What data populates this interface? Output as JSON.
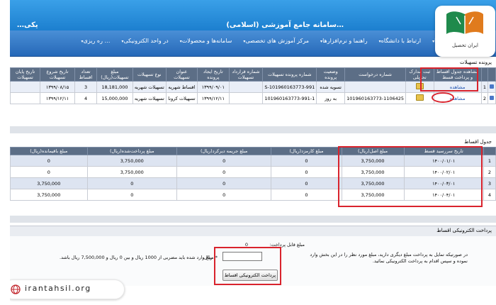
{
  "header": {
    "title": "…سامانه جامع آموزشی (اسلامی)",
    "left_fragment": "…یکی"
  },
  "nav": {
    "items": [
      {
        "label": "… ره ریزی"
      },
      {
        "label": "در واحد الکترونیکی"
      },
      {
        "label": "سامانه‌ها و محصولات"
      },
      {
        "label": "مرکز آموزش های تخصصی"
      },
      {
        "label": "راهنما و نرم‌افزارها"
      },
      {
        "label": "ارتباط با دانشگاه"
      },
      {
        "label": "سامانه مبدا"
      },
      {
        "label": "جستجو"
      }
    ]
  },
  "loans": {
    "section_label": "پرونده تسهیلات",
    "headers": [
      "",
      "",
      "مشاهده جدول اقساط و پرداخت قسط",
      "ثبت مدارک تحویلی",
      "شماره درخواست",
      "وضعیت پرونده",
      "شماره پرونده تسهیلات",
      "شماره قرارداد تسهیلات",
      "تاریخ ایجاد پرونده",
      "عنوان تسهیلات",
      "نوع تسهیلات",
      "مبلغ تسهیلات(ریال)",
      "تعداد اقساط",
      "تاریخ شروع تسهیلات",
      "تاریخ پایان تسهیلات"
    ],
    "rows": [
      {
        "num": "1",
        "view": "مشاهده",
        "request_no": "",
        "status": "تسویه شده",
        "file_no": "S-101960163773-991",
        "contract_no": "",
        "created": "۱۳۹۹/۰۹/۰۱",
        "title": "اقساط شهریه",
        "type": "تسهیلات شهریه",
        "amount": "18,181,000",
        "installments": "3",
        "start": "۱۳۹۹/۰۸/۱۵",
        "end": ""
      },
      {
        "num": "2",
        "view": "مشاهده",
        "request_no": "101960163773-1106425",
        "status": "به روز",
        "file_no": "101960163773-991-1",
        "contract_no": "",
        "created": "۱۳۹۹/۱۲/۱۱",
        "title": "تسهیلات کرونا",
        "type": "تسهیلات شهریه",
        "amount": "15,000,000",
        "installments": "4",
        "start": "۱۳۹۹/۱۲/۱۱",
        "end": ""
      }
    ]
  },
  "installments": {
    "section_label": "جدول اقساط",
    "headers": [
      "",
      "تاریخ سررسید قسط",
      "مبلغ اصل(ریال)",
      "مبلغ کارمزد(ریال)",
      "مبلغ جریمه دیرکرد(ریال)",
      "مبلغ پرداخت‌شده(ریال)",
      "مبلغ باقیمانده(ریال)"
    ],
    "rows": [
      {
        "num": "1",
        "due": "۱۴۰۰/۰۱/۰۱",
        "principal": "3,750,000",
        "fee": "0",
        "penalty": "0",
        "paid": "3,750,000",
        "remaining": "0"
      },
      {
        "num": "2",
        "due": "۱۴۰۰/۰۲/۰۱",
        "principal": "3,750,000",
        "fee": "0",
        "penalty": "0",
        "paid": "3,750,000",
        "remaining": "0"
      },
      {
        "num": "3",
        "due": "۱۴۰۰/۰۳/۰۱",
        "principal": "3,750,000",
        "fee": "0",
        "penalty": "0",
        "paid": "0",
        "remaining": "3,750,000"
      },
      {
        "num": "4",
        "due": "۱۴۰۰/۰۴/۰۱",
        "principal": "3,750,000",
        "fee": "0",
        "penalty": "0",
        "paid": "0",
        "remaining": "3,750,000"
      }
    ]
  },
  "payment": {
    "section_label": "پرداخت الکترونیکی اقساط",
    "payable_label": "مبلغ قابل پرداخت:",
    "payable_value": "0",
    "instructions": "در صورتیکه تمایل به پرداخت مبلغ دیگری دارید، مبلغ مورد نظر را در این بخش وارد نموده و سپس اقدام به پرداخت الکترونیکی نمائید.",
    "amount_value": "",
    "currency": "ریال",
    "note": "* مبلغ وارد شده باید مضربی از 1000 ریال و بین 0 ریال و 7,500,000 ریال باشد.",
    "button_label": "پرداخت الکترونیکی اقساط"
  },
  "brand": {
    "logo_text": "ایران تحصیل",
    "site_url": "irantahsil.org"
  },
  "colors": {
    "accent_red": "#d9232d",
    "nav_blue": "#2568b8",
    "header_gray": "#5c6e86"
  }
}
